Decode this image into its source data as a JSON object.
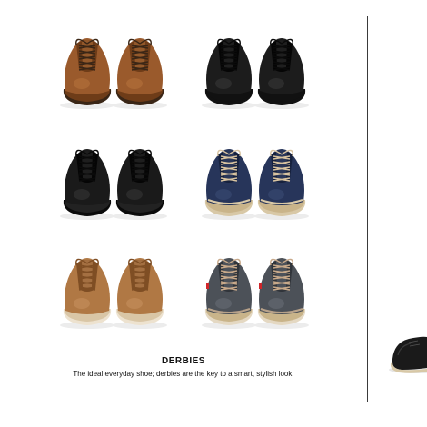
{
  "caption": {
    "title": "DERBIES",
    "tagline": "The ideal everyday shoe; derbies are the key to a smart, stylish look."
  },
  "shoes": [
    {
      "id": "tan-leather",
      "name": "tan-leather-derby-pair",
      "upper": "#9a5a2c",
      "upper_dark": "#6e3c18",
      "upper_light": "#b8753e",
      "sole": "#3a2616",
      "welt": "#6e3c18",
      "lace": "#3a2616",
      "cap": "none"
    },
    {
      "id": "black-leather-1",
      "name": "black-leather-derby-pair",
      "upper": "#1c1c1c",
      "upper_dark": "#050505",
      "upper_light": "#3a3a3a",
      "sole": "#111111",
      "welt": "#111111",
      "lace": "#0a0a0a",
      "cap": "none"
    },
    {
      "id": "black-leather-2",
      "name": "black-derby-pair-thick-sole",
      "upper": "#1a1a1a",
      "upper_dark": "#050505",
      "upper_light": "#383838",
      "sole": "#0a0a0a",
      "welt": "#222222",
      "lace": "#0a0a0a",
      "cap": "none"
    },
    {
      "id": "navy-suede",
      "name": "navy-suede-derby-pair",
      "upper": "#27355a",
      "upper_dark": "#16213d",
      "upper_light": "#3d4d76",
      "sole": "#d8c8a6",
      "welt": "#c9b48a",
      "lace": "#d8c3a0",
      "cap": "#d9c9a7"
    },
    {
      "id": "tan-light",
      "name": "light-tan-derby-pair",
      "upper": "#b07844",
      "upper_dark": "#7f4e24",
      "upper_light": "#c99160",
      "sole": "#ede2cf",
      "welt": "#d9c6a6",
      "lace": "#7f4e24",
      "cap": "none"
    },
    {
      "id": "grey-denim",
      "name": "grey-denim-derby-pair",
      "upper": "#4c5158",
      "upper_dark": "#30343a",
      "upper_light": "#6a7079",
      "sole": "#e4d8c2",
      "welt": "#c9b48a",
      "lace": "#c8a98a",
      "cap": "#b8a28a",
      "tab": "#d0262a"
    }
  ]
}
